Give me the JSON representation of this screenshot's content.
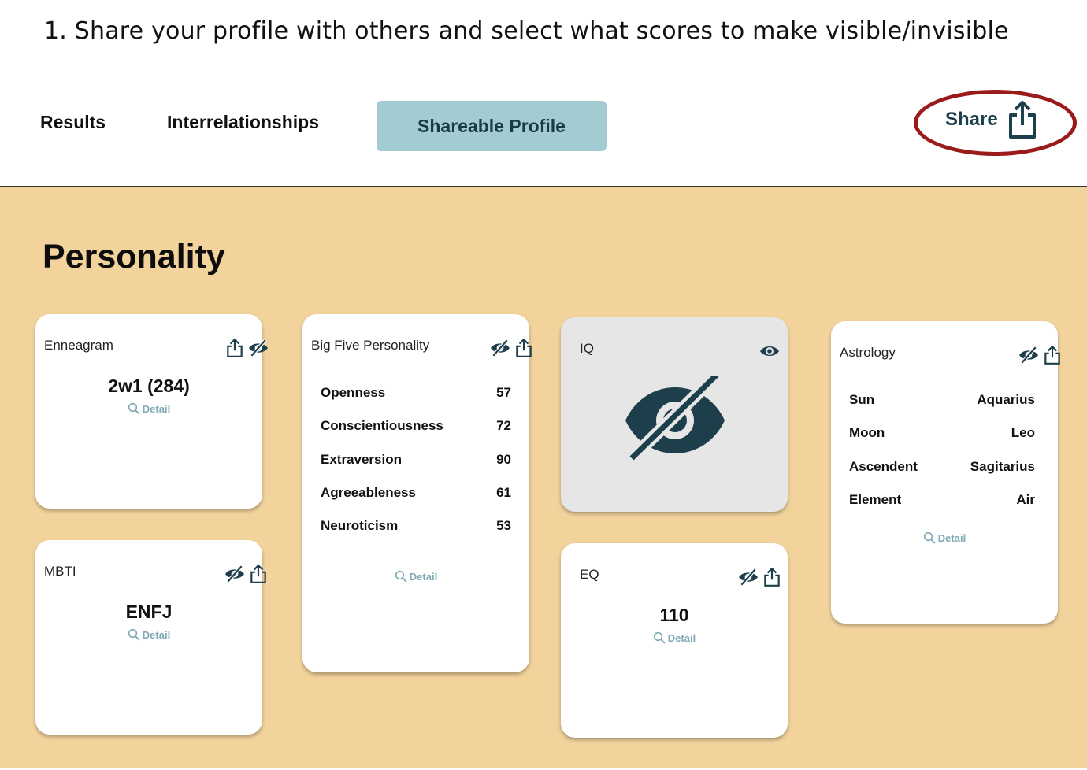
{
  "caption": "1. Share your profile with others and select what scores to make visible/invisible",
  "tabs": {
    "results": "Results",
    "interrelationships": "Interrelationships",
    "shareable_profile": "Shareable Profile"
  },
  "share": {
    "label": "Share",
    "icon": "share-icon",
    "highlight_color": "#9b1b1b"
  },
  "section_title": "Personality",
  "colors": {
    "accent": "#a2cbd2",
    "panel": "#f2d39c",
    "icon": "#1d3f4c",
    "detail": "#7fa9b5"
  },
  "cards": {
    "enneagram": {
      "title": "Enneagram",
      "value": "2w1 (284)",
      "detail": "Detail",
      "visible": true
    },
    "mbti": {
      "title": "MBTI",
      "value": "ENFJ",
      "detail": "Detail",
      "visible": false
    },
    "big_five": {
      "title": "Big Five Personality",
      "visible": false,
      "detail": "Detail",
      "traits": [
        {
          "label": "Openness",
          "value": "57"
        },
        {
          "label": "Conscientiousness",
          "value": "72"
        },
        {
          "label": "Extraversion",
          "value": "90"
        },
        {
          "label": "Agreeableness",
          "value": "61"
        },
        {
          "label": "Neuroticism",
          "value": "53"
        }
      ]
    },
    "iq": {
      "title": "IQ",
      "visible": false
    },
    "eq": {
      "title": "EQ",
      "value": "110",
      "detail": "Detail",
      "visible": false
    },
    "astrology": {
      "title": "Astrology",
      "visible": false,
      "detail": "Detail",
      "rows": [
        {
          "label": "Sun",
          "value": "Aquarius"
        },
        {
          "label": "Moon",
          "value": "Leo"
        },
        {
          "label": "Ascendent",
          "value": "Sagitarius"
        },
        {
          "label": "Element",
          "value": "Air"
        }
      ]
    }
  }
}
